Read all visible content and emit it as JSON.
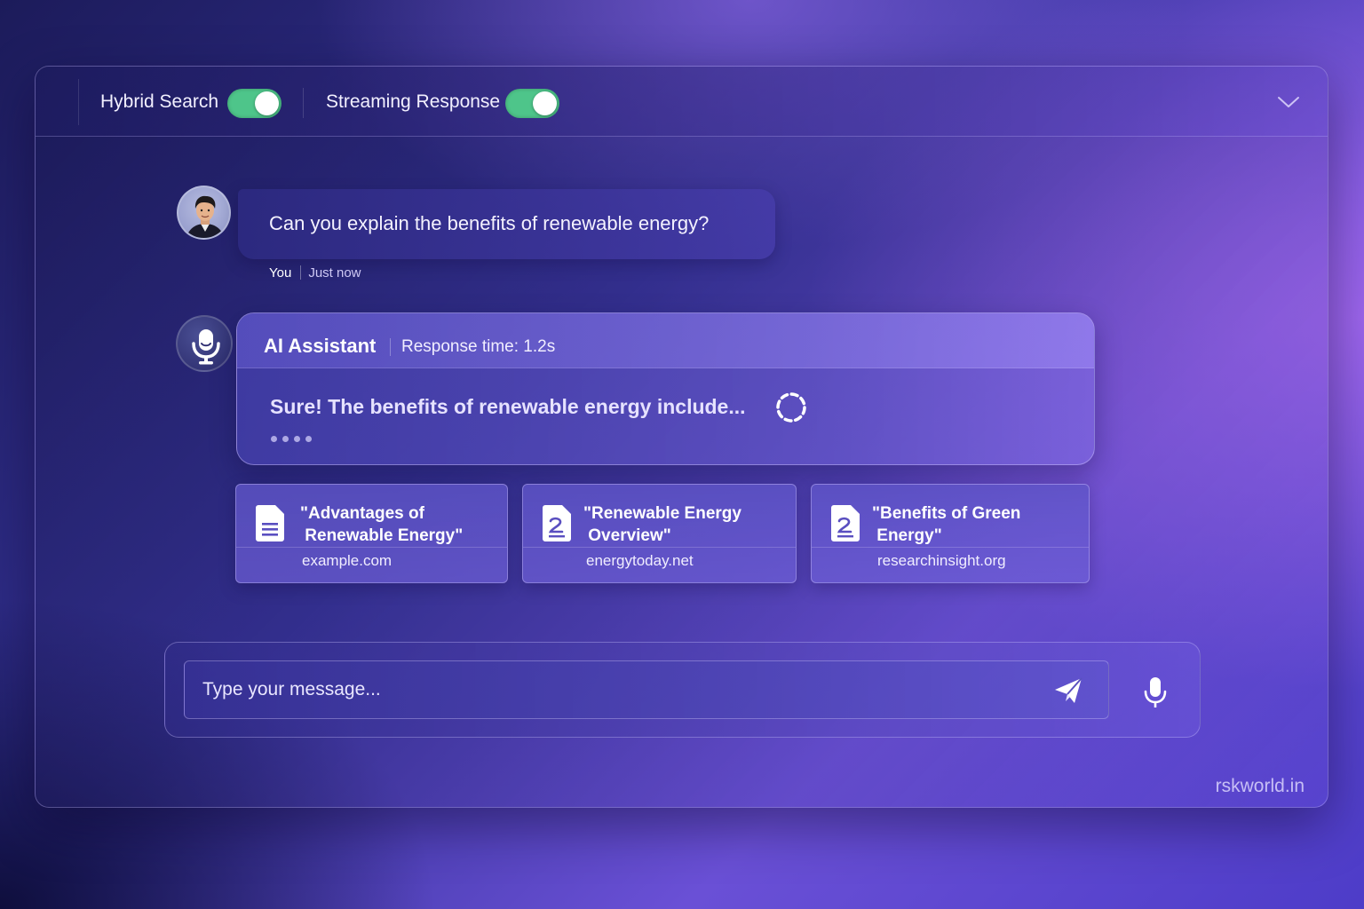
{
  "toolbar": {
    "hybrid_search": {
      "label": "Hybrid Search",
      "enabled": true
    },
    "streaming_response": {
      "label": "Streaming Response",
      "enabled": true
    },
    "toggle_color": "#4ec58a",
    "collapse_icon": "chevron-down-icon"
  },
  "conversation": {
    "user_message": {
      "text": "Can you explain the benefits of renewable energy?",
      "author": "You",
      "time": "Just now"
    },
    "assistant_message": {
      "name": "AI Assistant",
      "response_time": "Response time: 1.2s",
      "text": "Sure! The benefits of renewable energy include...",
      "status_icon": "loading-spinner-icon"
    },
    "sources": [
      {
        "title": "\"Advantages of\n Renewable Energy\"",
        "domain": "example.com",
        "icon": "document-lines-icon"
      },
      {
        "title": "\"Renewable Energy\n Overview\"",
        "domain": "energytoday.net",
        "icon": "document-2-icon"
      },
      {
        "title": "\"Benefits of Green\n Energy\"",
        "domain": "researchinsight.org",
        "icon": "document-2-icon"
      }
    ]
  },
  "composer": {
    "placeholder": "Type your message...",
    "value": "",
    "send_icon": "send-icon",
    "mic_icon": "microphone-icon"
  },
  "footer": {
    "watermark": "rskworld.in"
  },
  "theme": {
    "accent": "#6a50d6",
    "background_dark": "#1c1b5a"
  }
}
